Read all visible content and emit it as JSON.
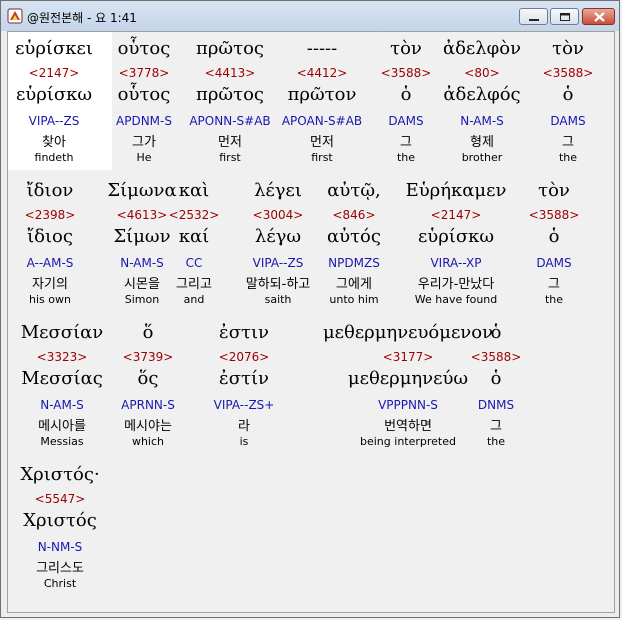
{
  "window": {
    "title": "@원전본해 - 요 1:41"
  },
  "rows": [
    [
      {
        "greek": "εὑρίσκει",
        "num": "<2147>",
        "lemma": "εὑρίσκω",
        "parse": "VIPA--ZS",
        "kor": "찾아",
        "eng": "findeth"
      },
      {
        "greek": "οὗτος",
        "num": "<3778>",
        "lemma": "οὗτος",
        "parse": "APDNM-S",
        "kor": "그가",
        "eng": "He"
      },
      {
        "greek": "πρῶτος",
        "num": "<4413>",
        "lemma": "πρῶτος",
        "parse": "APONN-S#AB",
        "kor": "먼저",
        "eng": "first"
      },
      {
        "greek": "-----",
        "num": "<4412>",
        "lemma": "πρῶτον",
        "parse": "APOAN-S#AB",
        "kor": "먼저",
        "eng": "first"
      },
      {
        "greek": "τὸν",
        "num": "<3588>",
        "lemma": "ὁ",
        "parse": "DAMS",
        "kor": "그",
        "eng": "the"
      },
      {
        "greek": "ἀδελφὸν",
        "num": "<80>",
        "lemma": "ἀδελφός",
        "parse": "N-AM-S",
        "kor": "형제",
        "eng": "brother"
      },
      {
        "greek": "τὸν",
        "num": "<3588>",
        "lemma": "ὁ",
        "parse": "DAMS",
        "kor": "그",
        "eng": "the"
      }
    ],
    [
      {
        "greek": "ἴδιον",
        "num": "<2398>",
        "lemma": "ἴδιος",
        "parse": "A--AM-S",
        "kor": "자기의",
        "eng": "his own"
      },
      {
        "greek": "Σίμωνα",
        "num": "<4613>",
        "lemma": "Σίμων",
        "parse": "N-AM-S",
        "kor": "시몬을",
        "eng": "Simon"
      },
      {
        "greek": "καὶ",
        "num": "<2532>",
        "lemma": "καί",
        "parse": "CC",
        "kor": "그리고",
        "eng": "and"
      },
      {
        "greek": "λέγει",
        "num": "<3004>",
        "lemma": "λέγω",
        "parse": "VIPA--ZS",
        "kor": "말하되-하고",
        "eng": "saith"
      },
      {
        "greek": "αὐτῷ,",
        "num": "<846>",
        "lemma": "αὐτός",
        "parse": "NPDMZS",
        "kor": "그에게",
        "eng": "unto him"
      },
      {
        "greek": "Εὑρήκαμεν",
        "num": "<2147>",
        "lemma": "εὑρίσκω",
        "parse": "VIRA--XP",
        "kor": "우리가-만났다",
        "eng": "We have found"
      },
      {
        "greek": "τὸν",
        "num": "<3588>",
        "lemma": "ὁ",
        "parse": "DAMS",
        "kor": "그",
        "eng": "the"
      }
    ],
    [
      {
        "greek": "Μεσσίαν",
        "num": "<3323>",
        "lemma": "Μεσσίας",
        "parse": "N-AM-S",
        "kor": "메시아를",
        "eng": "Messias"
      },
      {
        "greek": "ὅ",
        "num": "<3739>",
        "lemma": "ὅς",
        "parse": "APRNN-S",
        "kor": "메시야는",
        "eng": "which"
      },
      {
        "greek": "ἐστιν",
        "num": "<2076>",
        "lemma": "ἐστίν",
        "parse": "VIPA--ZS+",
        "kor": "라",
        "eng": "is"
      },
      {
        "greek": "μεθερμηνευόμενον",
        "num": "<3177>",
        "lemma": "μεθερμηνεύω",
        "parse": "VPPPNN-S",
        "kor": "번역하면",
        "eng": "being interpreted"
      },
      {
        "greek": "ὁ",
        "num": "<3588>",
        "lemma": "ὁ",
        "parse": "DNMS",
        "kor": "그",
        "eng": "the"
      }
    ],
    [
      {
        "greek": "Χριστός·",
        "num": "<5547>",
        "lemma": "Χριστός",
        "parse": "N-NM-S",
        "kor": "그리스도",
        "eng": "Christ"
      }
    ]
  ]
}
